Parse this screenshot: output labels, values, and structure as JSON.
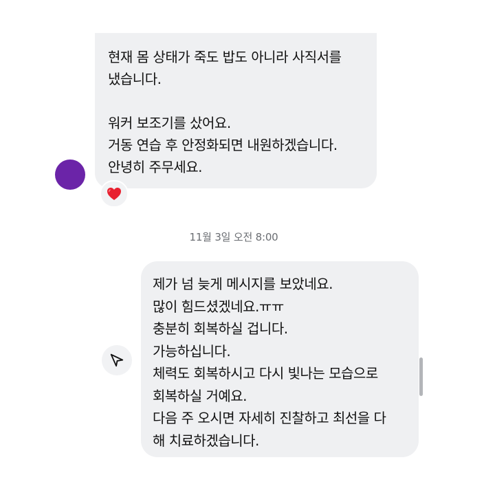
{
  "incoming_message": {
    "lines": [
      "현재 몸 상태가 죽도 밥도 아니라 사직서를",
      "냈습니다.",
      "",
      "워커 보조기를 샀어요.",
      "거동 연습 후 안정화되면 내원하겠습니다.",
      "안녕히 주무세요."
    ],
    "reaction": "❤️",
    "reaction_icon": "red-heart-icon",
    "avatar_color": "#6b24a8"
  },
  "timestamp": "11월 3일 오전 8:00",
  "outgoing_message": {
    "lines": [
      "제가 넘 늦게 메시지를 보았네요.",
      "많이 힘드셨겠네요.ㅠㅠ",
      "충분히 회복하실 겁니다.",
      "가능하십니다.",
      "체력도 회복하시고 다시 빛나는 모습으로",
      "회복하실 거예요.",
      "다음 주 오시면 자세히 진찰하고 최선을 다",
      "해 치료하겠습니다."
    ]
  },
  "share_button": {
    "icon": "paper-plane-icon"
  },
  "colors": {
    "bubble_background": "#eff0f2",
    "timestamp_text": "#6a6d72",
    "heart": "#e8202f"
  }
}
